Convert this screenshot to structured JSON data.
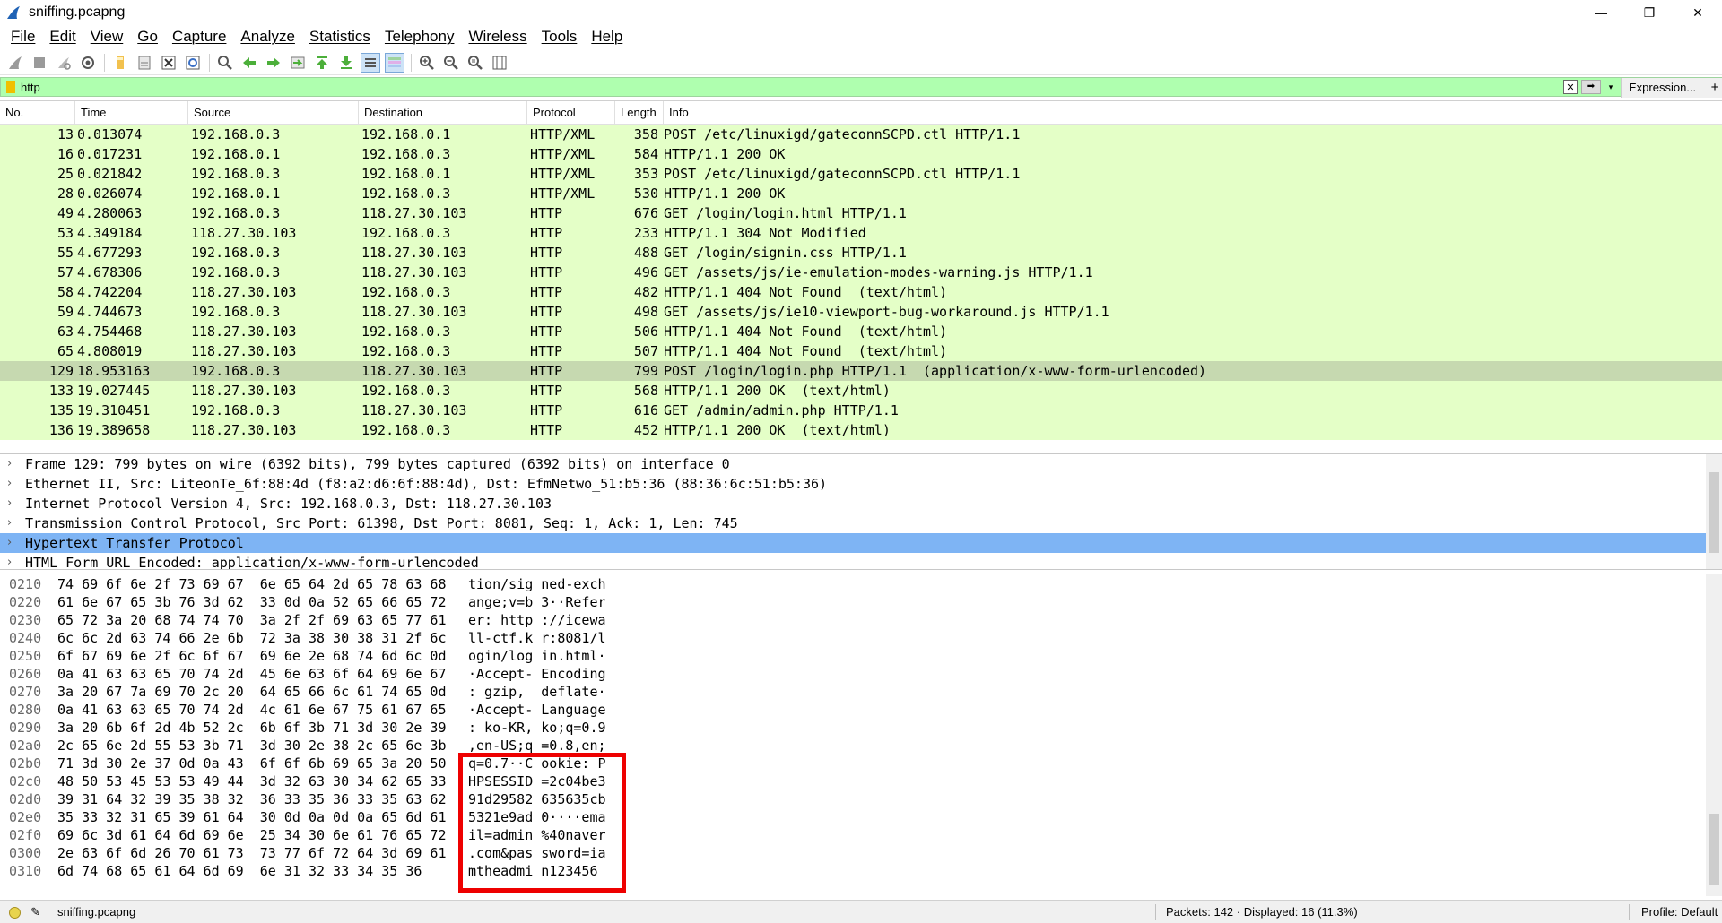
{
  "window": {
    "title": "sniffing.pcapng",
    "minimize": "—",
    "restore": "❐",
    "close": "✕"
  },
  "menu": [
    "File",
    "Edit",
    "View",
    "Go",
    "Capture",
    "Analyze",
    "Statistics",
    "Telephony",
    "Wireless",
    "Tools",
    "Help"
  ],
  "toolbar": {
    "icons": [
      "start-capture-icon",
      "stop-capture-icon",
      "restart-capture-icon",
      "capture-options-icon",
      "open-file-icon",
      "save-file-icon",
      "close-file-icon",
      "reload-file-icon",
      "find-packet-icon",
      "go-back-icon",
      "go-forward-icon",
      "go-to-packet-icon",
      "go-first-icon",
      "go-last-icon",
      "auto-scroll-icon",
      "colorize-icon",
      "zoom-in-icon",
      "zoom-out-icon",
      "zoom-normal-icon",
      "resize-columns-icon"
    ]
  },
  "filter": {
    "value": "http",
    "expression_label": "Expression...",
    "add_label": "+"
  },
  "packet_list": {
    "columns": [
      "No.",
      "Time",
      "Source",
      "Destination",
      "Protocol",
      "Length",
      "Info"
    ],
    "rows": [
      {
        "no": "13",
        "time": "0.013074",
        "src": "192.168.0.3",
        "dst": "192.168.0.1",
        "proto": "HTTP/XML",
        "len": "358",
        "info": "POST /etc/linuxigd/gateconnSCPD.ctl HTTP/1.1"
      },
      {
        "no": "16",
        "time": "0.017231",
        "src": "192.168.0.1",
        "dst": "192.168.0.3",
        "proto": "HTTP/XML",
        "len": "584",
        "info": "HTTP/1.1 200 OK"
      },
      {
        "no": "25",
        "time": "0.021842",
        "src": "192.168.0.3",
        "dst": "192.168.0.1",
        "proto": "HTTP/XML",
        "len": "353",
        "info": "POST /etc/linuxigd/gateconnSCPD.ctl HTTP/1.1"
      },
      {
        "no": "28",
        "time": "0.026074",
        "src": "192.168.0.1",
        "dst": "192.168.0.3",
        "proto": "HTTP/XML",
        "len": "530",
        "info": "HTTP/1.1 200 OK"
      },
      {
        "no": "49",
        "time": "4.280063",
        "src": "192.168.0.3",
        "dst": "118.27.30.103",
        "proto": "HTTP",
        "len": "676",
        "info": "GET /login/login.html HTTP/1.1"
      },
      {
        "no": "53",
        "time": "4.349184",
        "src": "118.27.30.103",
        "dst": "192.168.0.3",
        "proto": "HTTP",
        "len": "233",
        "info": "HTTP/1.1 304 Not Modified"
      },
      {
        "no": "55",
        "time": "4.677293",
        "src": "192.168.0.3",
        "dst": "118.27.30.103",
        "proto": "HTTP",
        "len": "488",
        "info": "GET /login/signin.css HTTP/1.1"
      },
      {
        "no": "57",
        "time": "4.678306",
        "src": "192.168.0.3",
        "dst": "118.27.30.103",
        "proto": "HTTP",
        "len": "496",
        "info": "GET /assets/js/ie-emulation-modes-warning.js HTTP/1.1"
      },
      {
        "no": "58",
        "time": "4.742204",
        "src": "118.27.30.103",
        "dst": "192.168.0.3",
        "proto": "HTTP",
        "len": "482",
        "info": "HTTP/1.1 404 Not Found  (text/html)"
      },
      {
        "no": "59",
        "time": "4.744673",
        "src": "192.168.0.3",
        "dst": "118.27.30.103",
        "proto": "HTTP",
        "len": "498",
        "info": "GET /assets/js/ie10-viewport-bug-workaround.js HTTP/1.1"
      },
      {
        "no": "63",
        "time": "4.754468",
        "src": "118.27.30.103",
        "dst": "192.168.0.3",
        "proto": "HTTP",
        "len": "506",
        "info": "HTTP/1.1 404 Not Found  (text/html)"
      },
      {
        "no": "65",
        "time": "4.808019",
        "src": "118.27.30.103",
        "dst": "192.168.0.3",
        "proto": "HTTP",
        "len": "507",
        "info": "HTTP/1.1 404 Not Found  (text/html)"
      },
      {
        "no": "129",
        "time": "18.953163",
        "src": "192.168.0.3",
        "dst": "118.27.30.103",
        "proto": "HTTP",
        "len": "799",
        "info": "POST /login/login.php HTTP/1.1  (application/x-www-form-urlencoded)",
        "selected": true
      },
      {
        "no": "133",
        "time": "19.027445",
        "src": "118.27.30.103",
        "dst": "192.168.0.3",
        "proto": "HTTP",
        "len": "568",
        "info": "HTTP/1.1 200 OK  (text/html)"
      },
      {
        "no": "135",
        "time": "19.310451",
        "src": "192.168.0.3",
        "dst": "118.27.30.103",
        "proto": "HTTP",
        "len": "616",
        "info": "GET /admin/admin.php HTTP/1.1"
      },
      {
        "no": "136",
        "time": "19.389658",
        "src": "118.27.30.103",
        "dst": "192.168.0.3",
        "proto": "HTTP",
        "len": "452",
        "info": "HTTP/1.1 200 OK  (text/html)"
      }
    ]
  },
  "details": [
    {
      "text": "Frame 129: 799 bytes on wire (6392 bits), 799 bytes captured (6392 bits) on interface 0"
    },
    {
      "text": "Ethernet II, Src: LiteonTe_6f:88:4d (f8:a2:d6:6f:88:4d), Dst: EfmNetwo_51:b5:36 (88:36:6c:51:b5:36)"
    },
    {
      "text": "Internet Protocol Version 4, Src: 192.168.0.3, Dst: 118.27.30.103"
    },
    {
      "text": "Transmission Control Protocol, Src Port: 61398, Dst Port: 8081, Seq: 1, Ack: 1, Len: 745"
    },
    {
      "text": "Hypertext Transfer Protocol",
      "highlight": true
    },
    {
      "text": "HTML Form URL Encoded: application/x-www-form-urlencoded"
    }
  ],
  "bytes": [
    {
      "off": "0210",
      "hex": "74 69 6f 6e 2f 73 69 67  6e 65 64 2d 65 78 63 68",
      "ascii": "tion/sig ned-exch"
    },
    {
      "off": "0220",
      "hex": "61 6e 67 65 3b 76 3d 62  33 0d 0a 52 65 66 65 72",
      "ascii": "ange;v=b 3··Refer"
    },
    {
      "off": "0230",
      "hex": "65 72 3a 20 68 74 74 70  3a 2f 2f 69 63 65 77 61",
      "ascii": "er: http ://icewa"
    },
    {
      "off": "0240",
      "hex": "6c 6c 2d 63 74 66 2e 6b  72 3a 38 30 38 31 2f 6c",
      "ascii": "ll-ctf.k r:8081/l"
    },
    {
      "off": "0250",
      "hex": "6f 67 69 6e 2f 6c 6f 67  69 6e 2e 68 74 6d 6c 0d",
      "ascii": "ogin/log in.html·"
    },
    {
      "off": "0260",
      "hex": "0a 41 63 63 65 70 74 2d  45 6e 63 6f 64 69 6e 67",
      "ascii": "·Accept- Encoding"
    },
    {
      "off": "0270",
      "hex": "3a 20 67 7a 69 70 2c 20  64 65 66 6c 61 74 65 0d",
      "ascii": ": gzip,  deflate·"
    },
    {
      "off": "0280",
      "hex": "0a 41 63 63 65 70 74 2d  4c 61 6e 67 75 61 67 65",
      "ascii": "·Accept- Language"
    },
    {
      "off": "0290",
      "hex": "3a 20 6b 6f 2d 4b 52 2c  6b 6f 3b 71 3d 30 2e 39",
      "ascii": ": ko-KR, ko;q=0.9"
    },
    {
      "off": "02a0",
      "hex": "2c 65 6e 2d 55 53 3b 71  3d 30 2e 38 2c 65 6e 3b",
      "ascii": ",en-US;q =0.8,en;"
    },
    {
      "off": "02b0",
      "hex": "71 3d 30 2e 37 0d 0a 43  6f 6f 6b 69 65 3a 20 50",
      "ascii": "q=0.7··C ookie: P"
    },
    {
      "off": "02c0",
      "hex": "48 50 53 45 53 53 49 44  3d 32 63 30 34 62 65 33",
      "ascii": "HPSESSID =2c04be3"
    },
    {
      "off": "02d0",
      "hex": "39 31 64 32 39 35 38 32  36 33 35 36 33 35 63 62",
      "ascii": "91d29582 635635cb"
    },
    {
      "off": "02e0",
      "hex": "35 33 32 31 65 39 61 64  30 0d 0a 0d 0a 65 6d 61",
      "ascii": "5321e9ad 0····ema"
    },
    {
      "off": "02f0",
      "hex": "69 6c 3d 61 64 6d 69 6e  25 34 30 6e 61 76 65 72",
      "ascii": "il=admin %40naver"
    },
    {
      "off": "0300",
      "hex": "2e 63 6f 6d 26 70 61 73  73 77 6f 72 64 3d 69 61",
      "ascii": ".com&pas sword=ia"
    },
    {
      "off": "0310",
      "hex": "6d 74 68 65 61 64 6d 69  6e 31 32 33 34 35 36",
      "ascii": "mtheadmi n123456"
    }
  ],
  "status": {
    "file": "sniffing.pcapng",
    "packets": "Packets: 142 · Displayed: 16 (11.3%)",
    "profile": "Profile: Default"
  },
  "colors": {
    "filter_bg": "#afffaf",
    "row_bg": "#e4ffc7",
    "row_selected_bg": "#c6d9b0",
    "detail_highlight": "#7eb4f4",
    "annotation_box": "#ee0000"
  }
}
